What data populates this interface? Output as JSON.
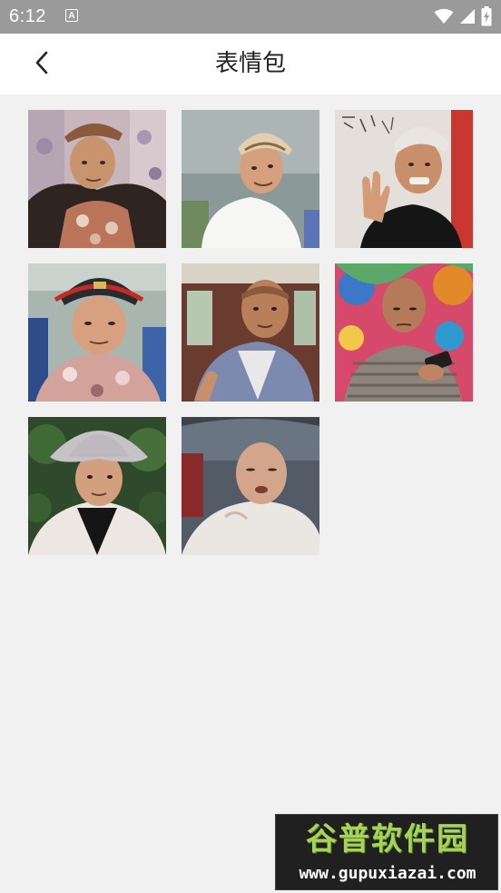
{
  "status_bar": {
    "time": "6:12",
    "notification_glyph": "A",
    "icons": [
      "wifi-icon",
      "cellular-signal-icon",
      "battery-charging-icon"
    ]
  },
  "app_bar": {
    "back_icon": "chevron-left-icon",
    "title": "表情包"
  },
  "stickers": [
    {
      "name": "sticker-1"
    },
    {
      "name": "sticker-2"
    },
    {
      "name": "sticker-3"
    },
    {
      "name": "sticker-4"
    },
    {
      "name": "sticker-5"
    },
    {
      "name": "sticker-6"
    },
    {
      "name": "sticker-7"
    },
    {
      "name": "sticker-8"
    }
  ],
  "watermark": {
    "brand": "谷普软件园",
    "url": "www.gupuxiazai.com"
  },
  "colors": {
    "status_bar": "#9a9a9a",
    "app_bar": "#ffffff",
    "background": "#f1f1f1",
    "title_text": "#222222"
  }
}
